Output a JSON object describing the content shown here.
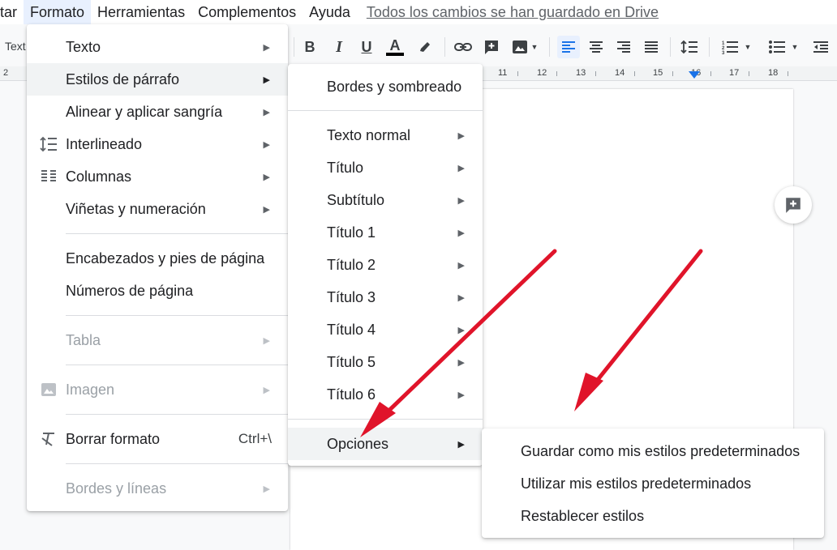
{
  "menubar": {
    "items": [
      "rtar",
      "Formato",
      "Herramientas",
      "Complementos",
      "Ayuda"
    ],
    "active_index": 1,
    "saved_status": "Todos los cambios se han guardado en Drive"
  },
  "toolbar": {
    "style_label": "Text",
    "bold": "B",
    "italic": "I",
    "underline": "U",
    "text_color": "A",
    "active_align": "align-left"
  },
  "ruler": {
    "labels": [
      "2",
      "11",
      "12",
      "13",
      "14",
      "15",
      "16",
      "17",
      "18"
    ]
  },
  "format_menu": {
    "items": [
      {
        "label": "Texto",
        "icon": "",
        "submenu": true,
        "disabled": false
      },
      {
        "label": "Estilos de párrafo",
        "icon": "",
        "submenu": true,
        "disabled": false,
        "highlighted": true
      },
      {
        "label": "Alinear y aplicar sangría",
        "icon": "",
        "submenu": true,
        "disabled": false
      },
      {
        "label": "Interlineado",
        "icon": "line-spacing-icon",
        "submenu": true,
        "disabled": false
      },
      {
        "label": "Columnas",
        "icon": "columns-icon",
        "submenu": true,
        "disabled": false
      },
      {
        "label": "Viñetas y numeración",
        "icon": "",
        "submenu": true,
        "disabled": false
      },
      {
        "label": "Encabezados y pies de página",
        "icon": "",
        "submenu": false,
        "disabled": false
      },
      {
        "label": "Números de página",
        "icon": "",
        "submenu": false,
        "disabled": false
      },
      {
        "label": "Tabla",
        "icon": "",
        "submenu": true,
        "disabled": true
      },
      {
        "label": "Imagen",
        "icon": "image-icon",
        "submenu": true,
        "disabled": true
      },
      {
        "label": "Borrar formato",
        "icon": "clear-format-icon",
        "submenu": false,
        "disabled": false,
        "shortcut": "Ctrl+\\"
      },
      {
        "label": "Bordes y líneas",
        "icon": "",
        "submenu": true,
        "disabled": true
      }
    ]
  },
  "paragraph_styles_menu": {
    "items": [
      {
        "label": "Bordes y sombreado",
        "submenu": false
      },
      {
        "label": "Texto normal",
        "submenu": true
      },
      {
        "label": "Título",
        "submenu": true
      },
      {
        "label": "Subtítulo",
        "submenu": true
      },
      {
        "label": "Título 1",
        "submenu": true
      },
      {
        "label": "Título 2",
        "submenu": true
      },
      {
        "label": "Título 3",
        "submenu": true
      },
      {
        "label": "Título 4",
        "submenu": true
      },
      {
        "label": "Título 5",
        "submenu": true
      },
      {
        "label": "Título 6",
        "submenu": true
      },
      {
        "label": "Opciones",
        "submenu": true,
        "highlighted": true
      }
    ]
  },
  "options_menu": {
    "items": [
      "Guardar como mis estilos predeterminados",
      "Utilizar mis estilos predeterminados",
      "Restablecer estilos"
    ]
  },
  "colors": {
    "accent": "#1a73e8",
    "highlight": "#f1f3f4",
    "disabled": "#9aa0a6",
    "annotation_arrow": "#e0142a"
  }
}
